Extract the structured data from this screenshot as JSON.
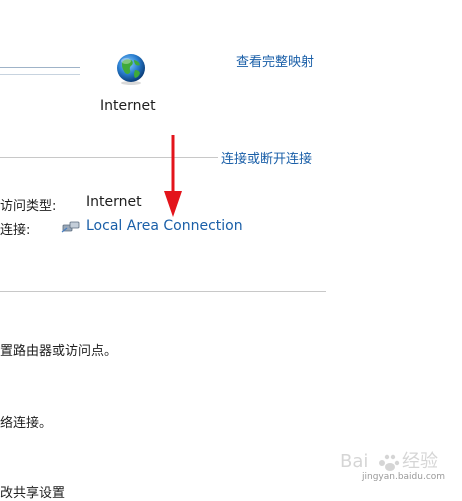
{
  "network_map": {
    "node_label": "Internet",
    "view_full_map": "查看完整映射"
  },
  "connect_disconnect": "连接或断开连接",
  "details": {
    "access_type_label": "访问类型:",
    "access_type_value": "Internet",
    "connection_label": "连接:",
    "connection_value": "Local Area Connection"
  },
  "tasks": {
    "line1": "置路由器或访问点。",
    "line2": "络连接。",
    "line3": "改共享设置"
  },
  "watermark": {
    "text": "jingyan.baidu.com"
  },
  "colors": {
    "link": "#1a5fa8",
    "annotation_arrow": "#e3141b"
  }
}
